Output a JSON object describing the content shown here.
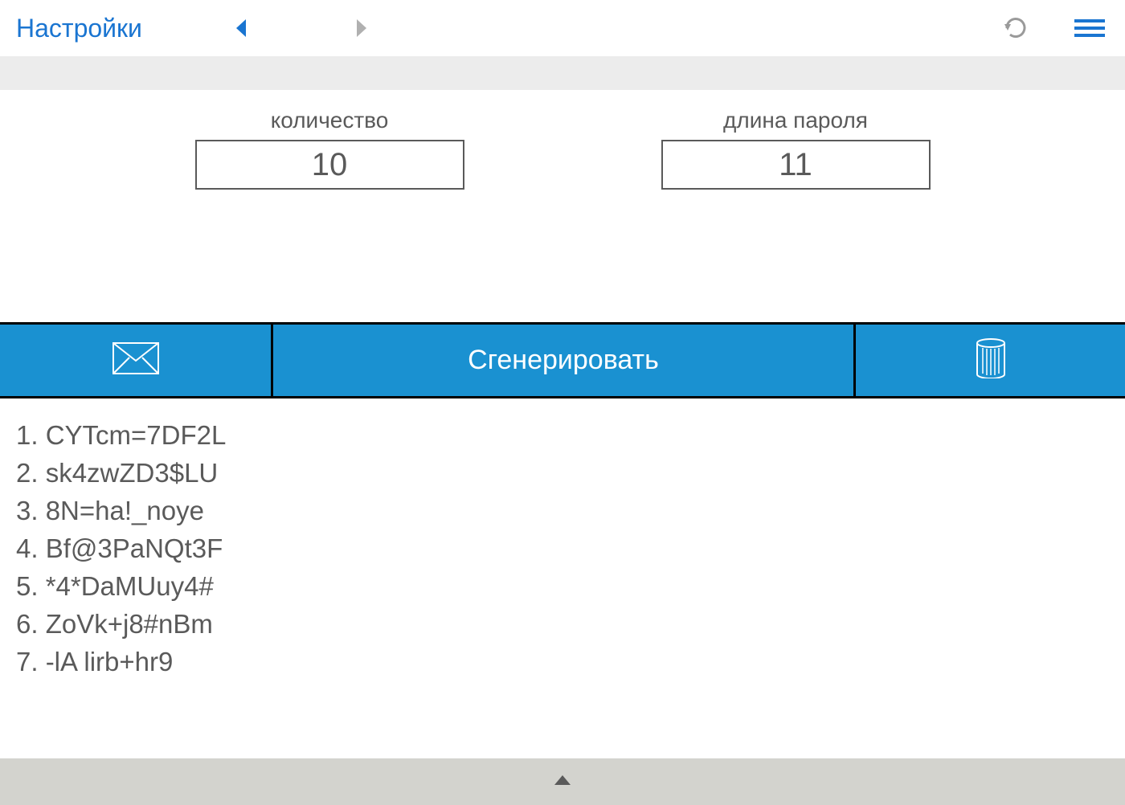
{
  "topBar": {
    "settingsLabel": "Настройки"
  },
  "inputs": {
    "count": {
      "label": "количество",
      "value": "10"
    },
    "length": {
      "label": "длина пароля",
      "value": "11"
    }
  },
  "buttons": {
    "generateLabel": "Сгенерировать"
  },
  "passwords": [
    "1. CYTcm=7DF2L",
    "2. sk4zwZD3$LU",
    "3. 8N=ha!_noye",
    "4. Bf@3PaNQt3F",
    "5. *4*DaMUuy4#",
    "6. ZoVk+j8#nBm",
    "7. -lA lirb+hr9"
  ]
}
